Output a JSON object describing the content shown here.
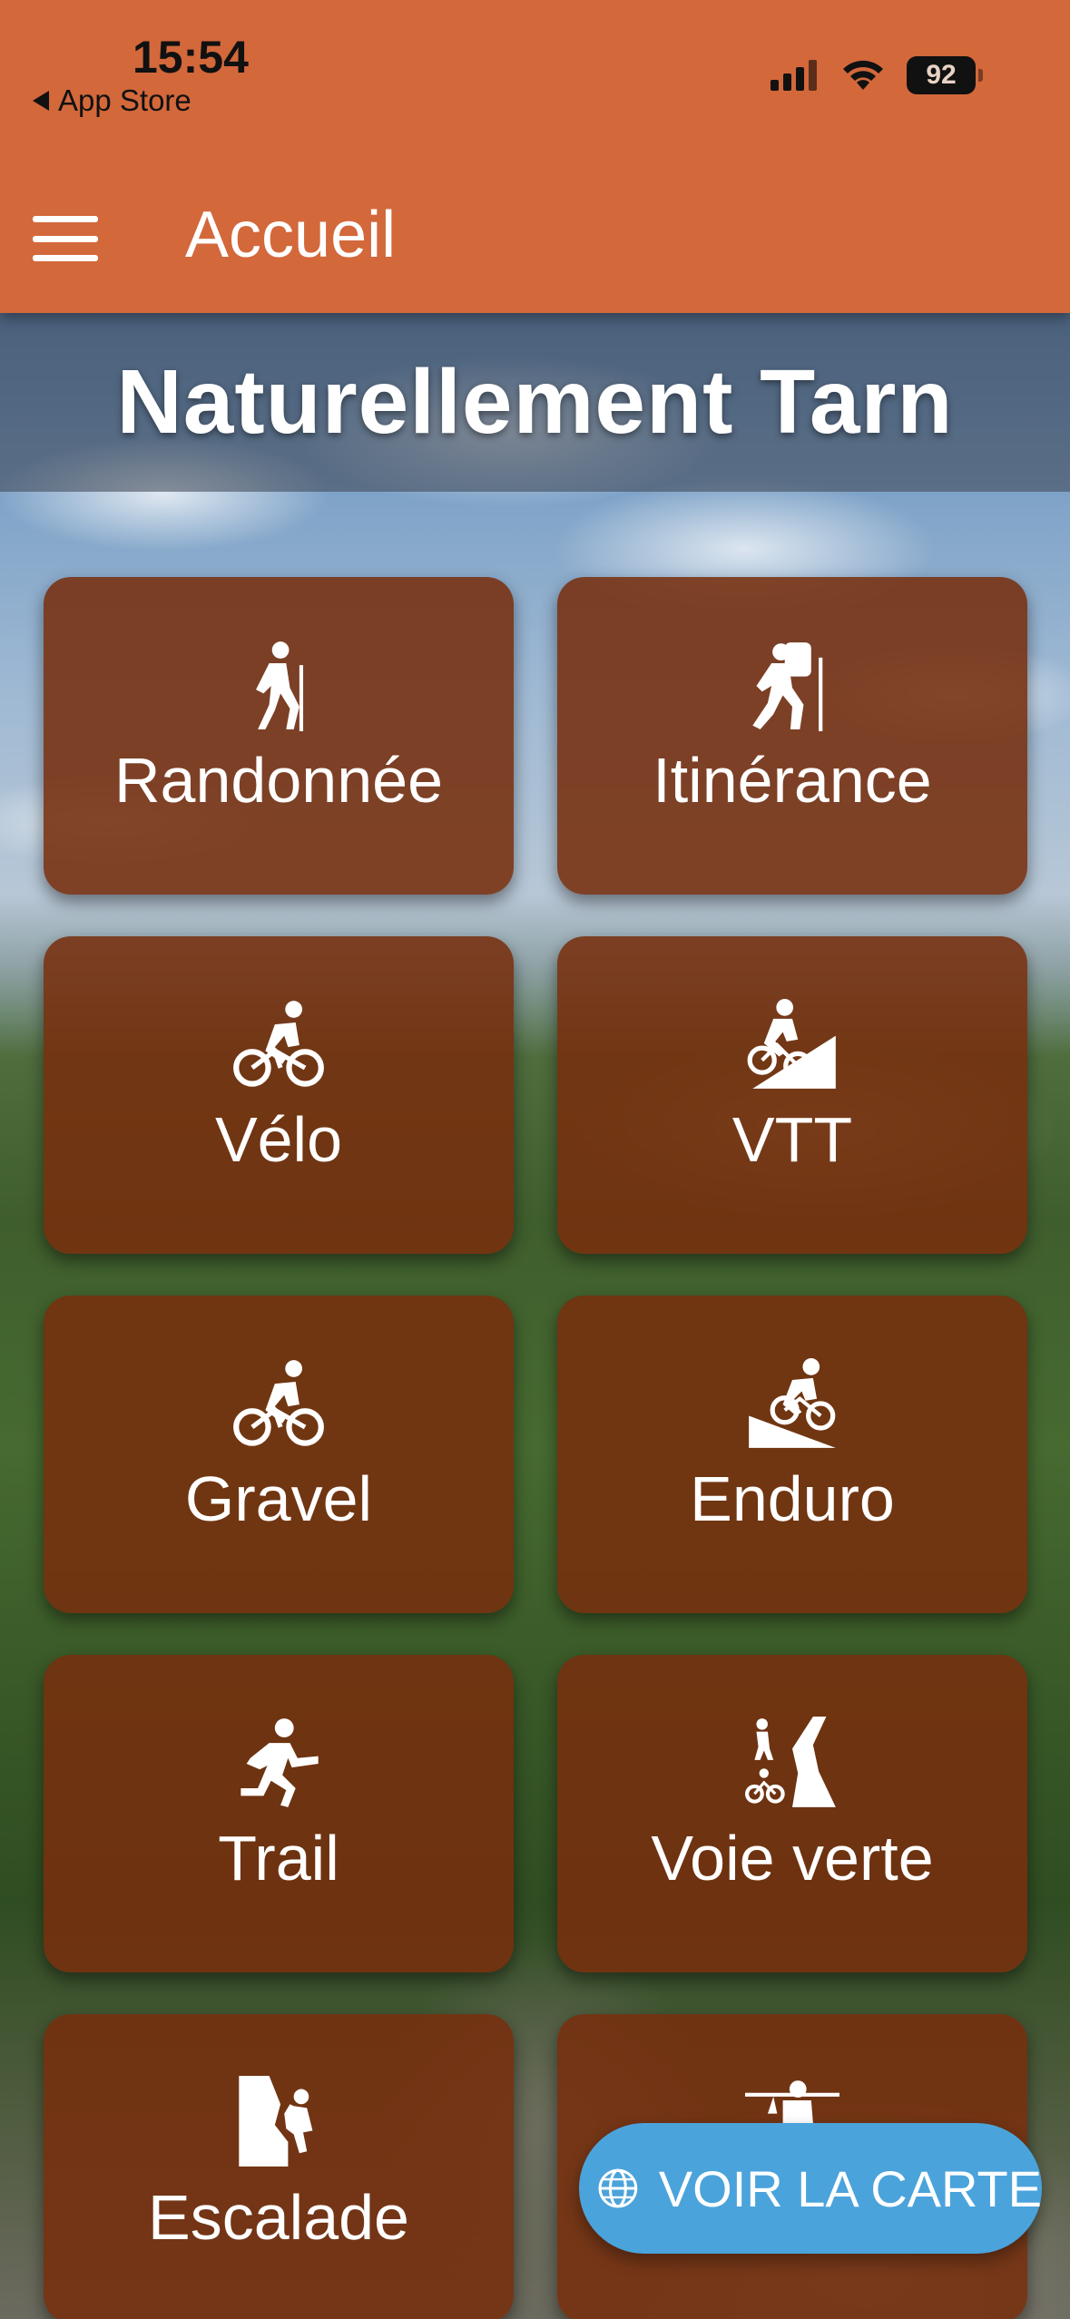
{
  "status_bar": {
    "time": "15:54",
    "back_label": "App Store",
    "battery": "92"
  },
  "app_bar": {
    "title": "Accueil",
    "background": "#d3683b"
  },
  "hero": {
    "title": "Naturellement Tarn"
  },
  "activities": [
    {
      "label": "Randonnée",
      "icon": "hiker-icon"
    },
    {
      "label": "Itinérance",
      "icon": "backpacker-icon"
    },
    {
      "label": "Vélo",
      "icon": "cyclist-icon"
    },
    {
      "label": "VTT",
      "icon": "mountain-bike-icon"
    },
    {
      "label": "Gravel",
      "icon": "gravel-bike-icon"
    },
    {
      "label": "Enduro",
      "icon": "enduro-bike-icon"
    },
    {
      "label": "Trail",
      "icon": "runner-icon"
    },
    {
      "label": "Voie verte",
      "icon": "greenway-icon"
    },
    {
      "label": "Escalade",
      "icon": "climber-icon"
    },
    {
      "label": "",
      "icon": "caving-icon"
    }
  ],
  "map_button": {
    "label": "VOIR LA CARTE",
    "icon": "globe-icon",
    "color": "#4ba3db"
  },
  "colors": {
    "tile": "#762f0e",
    "accent": "#d3683b"
  }
}
